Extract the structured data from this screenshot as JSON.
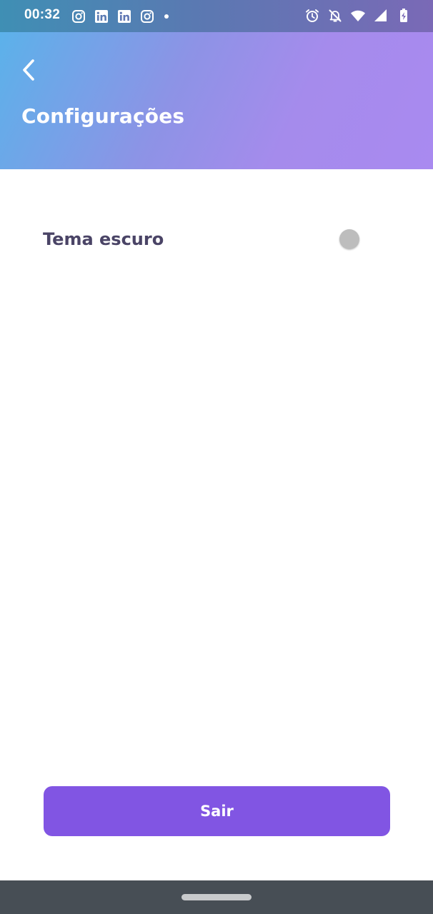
{
  "status_bar": {
    "time": "00:32",
    "left_icons": [
      "instagram-icon",
      "linkedin-icon",
      "linkedin-icon",
      "instagram-icon",
      "notification-dot-icon"
    ],
    "right_icons": [
      "alarm-icon",
      "notifications-off-icon",
      "wifi-icon",
      "signal-icon",
      "battery-charging-icon"
    ]
  },
  "header": {
    "back_icon": "chevron-left-icon",
    "title": "Configurações"
  },
  "settings": {
    "dark_theme": {
      "label": "Tema escuro",
      "enabled": false
    }
  },
  "actions": {
    "logout_label": "Sair"
  },
  "colors": {
    "header_gradient_start": "#58b4ea",
    "header_gradient_end": "#a98af0",
    "button": "#8155e3",
    "label": "#4a4466",
    "toggle_off": "#bdbdbd",
    "nav_bar": "#474e55"
  }
}
